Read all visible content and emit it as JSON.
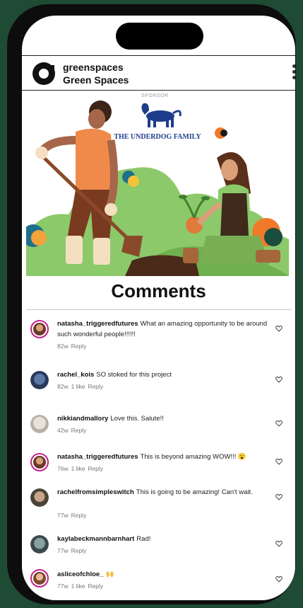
{
  "colors": {
    "background": "#1f4a33",
    "accent_ring": "#c2208c",
    "sponsor_blue": "#1d3d8c",
    "leaf_green": "#8cc96a"
  },
  "profile": {
    "handle": "greenspaces",
    "display_name": "Green Spaces"
  },
  "banner": {
    "sponsor_label": "SPONSOR",
    "sponsor_name": "THE UNDERDOG FAMILY"
  },
  "comments_title": "Comments",
  "comments": [
    {
      "user": "natasha_triggeredfutures",
      "text": "What an amazing opportunity to be around such wonderful people!!!!!!",
      "age": "82w",
      "likes": "",
      "reply": "Reply"
    },
    {
      "user": "rachel_kois",
      "text": "SO stoked for this project",
      "age": "82w",
      "likes": "1 like",
      "reply": "Reply"
    },
    {
      "user": "nikkiandmallory",
      "text": "Love this. Salute!!",
      "age": "42w",
      "likes": "",
      "reply": "Reply"
    },
    {
      "user": "natasha_triggeredfutures",
      "text": "This is beyond amazing WOW!!! 😮",
      "age": "76w",
      "likes": "1 like",
      "reply": "Reply"
    },
    {
      "user": "rachelfromsimpleswitch",
      "text": "This is going to be amazing! Can't wait.",
      "age": "77w",
      "likes": "",
      "reply": "Reply"
    },
    {
      "user": "kaylabeckmannbarnhart",
      "text": "Rad!",
      "age": "77w",
      "likes": "",
      "reply": "Reply"
    },
    {
      "user": "asliceofchloe_",
      "text": "🙌",
      "age": "77w",
      "likes": "1 like",
      "reply": "Reply"
    }
  ]
}
